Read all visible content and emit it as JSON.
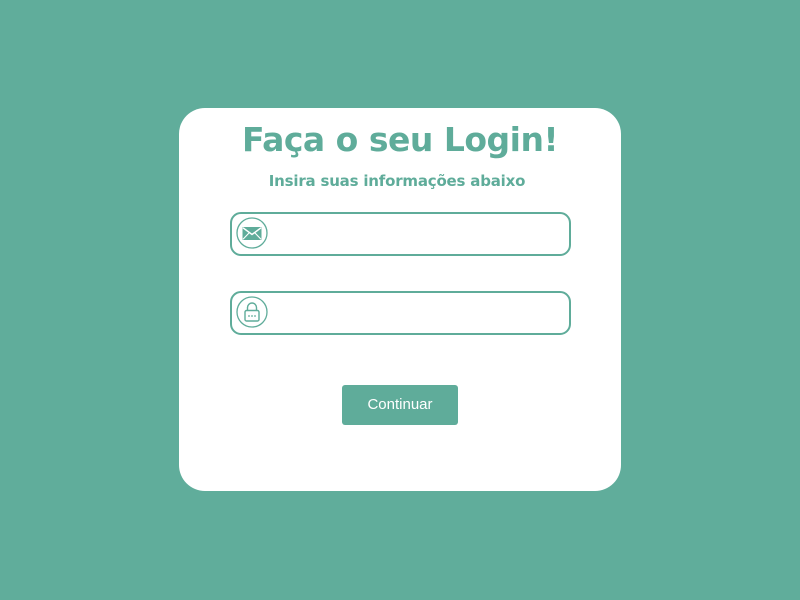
{
  "colors": {
    "background": "#60ad9b",
    "accent": "#5fac9a",
    "card": "#ffffff",
    "button_text": "#ffffff"
  },
  "login": {
    "title": "Faça o seu Login!",
    "subtitle": "Insira suas informações abaixo",
    "email": {
      "icon": "envelope-icon",
      "value": "",
      "placeholder": ""
    },
    "password": {
      "icon": "lock-icon",
      "value": "",
      "placeholder": ""
    },
    "continue_label": "Continuar"
  }
}
